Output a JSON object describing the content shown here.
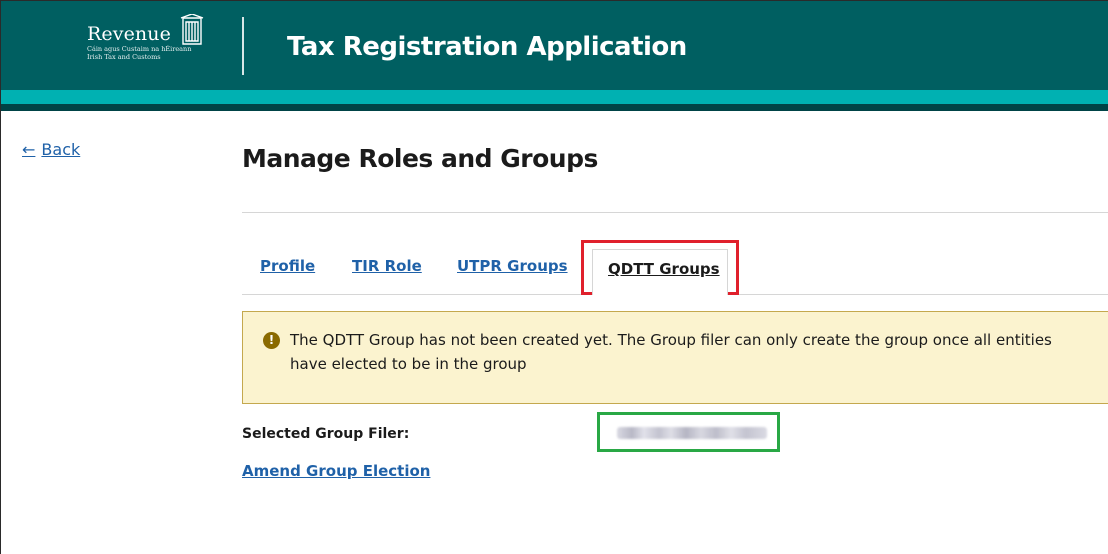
{
  "header": {
    "logo_name": "Revenue",
    "logo_sub_1": "Cáin agus Custaim na hÉireann",
    "logo_sub_2": "Irish Tax and Customs",
    "app_title": "Tax Registration Application"
  },
  "nav": {
    "back_label": "Back",
    "back_arrow": "←"
  },
  "page": {
    "title": "Manage Roles and Groups"
  },
  "tabs": [
    {
      "label": "Profile",
      "active": false
    },
    {
      "label": "TIR Role",
      "active": false
    },
    {
      "label": "UTPR Groups",
      "active": false
    },
    {
      "label": "QDTT Groups",
      "active": true
    }
  ],
  "alert": {
    "icon": "!",
    "message": "The QDTT Group has not been created yet. The Group filer can only create the group once all entities have elected to be in the group"
  },
  "group_filer": {
    "label": "Selected Group Filer:",
    "value_redacted": true
  },
  "actions": {
    "amend_label": "Amend Group Election"
  },
  "colors": {
    "header_bg": "#005f61",
    "header_stripe": "#00b1b2",
    "link": "#1f61a8",
    "alert_bg": "#fbf3cf",
    "highlight_red": "#e0202c",
    "highlight_green": "#29a845"
  }
}
